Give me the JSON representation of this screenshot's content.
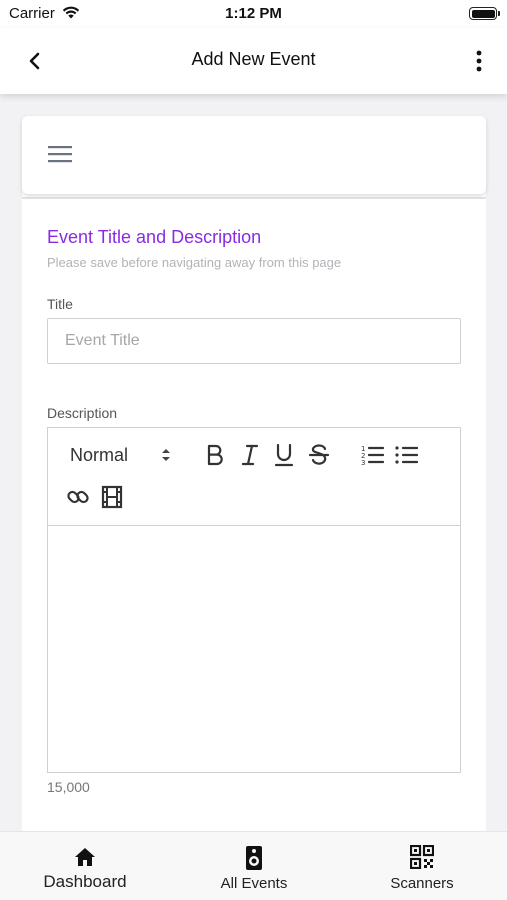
{
  "status_bar": {
    "carrier": "Carrier",
    "time": "1:12 PM"
  },
  "header": {
    "title": "Add New Event",
    "back_icon": "chevron-left-icon",
    "more_icon": "more-vertical-icon"
  },
  "content": {
    "menu_icon": "hamburger-icon",
    "section_title": "Event Title and Description",
    "section_subtitle": "Please save before navigating away from this page",
    "title_label": "Title",
    "title_value": "",
    "title_placeholder": "Event Title",
    "description_label": "Description",
    "editor": {
      "format_selected": "Normal",
      "buttons": [
        "bold-icon",
        "italic-icon",
        "underline-icon",
        "strikethrough-icon",
        "ordered-list-icon",
        "bullet-list-icon",
        "link-icon",
        "video-icon"
      ],
      "body": ""
    },
    "char_count": "15,000"
  },
  "bottom_nav": {
    "items": [
      {
        "label": "Dashboard",
        "icon": "home-icon"
      },
      {
        "label": "All Events",
        "icon": "speaker-icon"
      },
      {
        "label": "Scanners",
        "icon": "qr-code-icon"
      }
    ]
  },
  "colors": {
    "accent": "#8a2be2",
    "background": "#f2f2f4",
    "card": "#ffffff"
  }
}
